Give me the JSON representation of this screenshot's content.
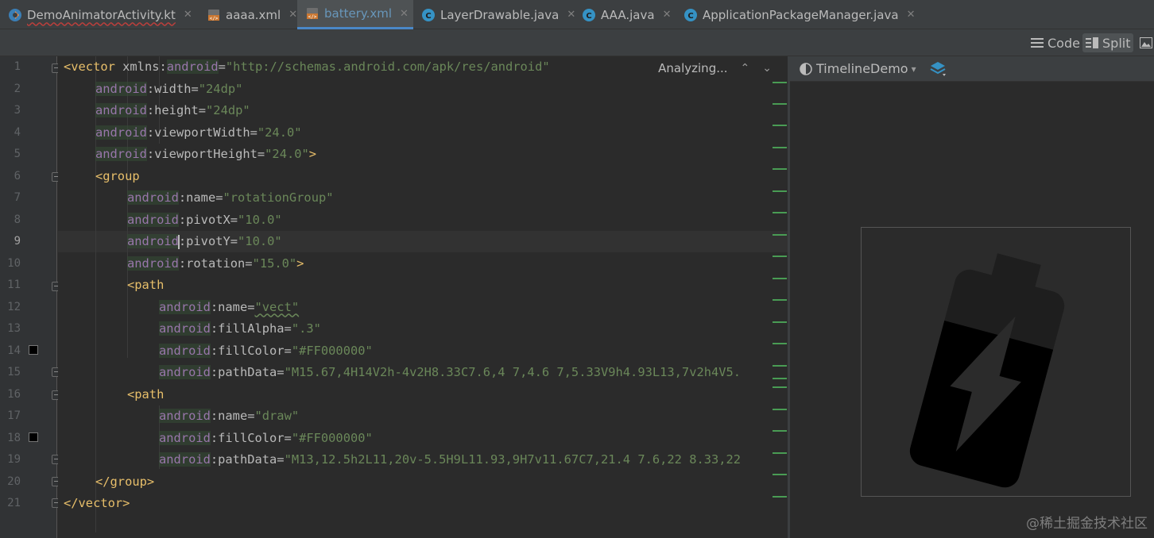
{
  "tabs": [
    {
      "label": "DemoAnimatorActivity.kt",
      "icon": "kotlin-activity-icon",
      "active": false
    },
    {
      "label": "aaaa.xml",
      "icon": "xml-file-icon",
      "active": false
    },
    {
      "label": "battery.xml",
      "icon": "xml-file-icon",
      "active": true
    },
    {
      "label": "LayerDrawable.java",
      "icon": "java-class-icon",
      "active": false
    },
    {
      "label": "AAA.java",
      "icon": "java-class-icon",
      "active": false
    },
    {
      "label": "ApplicationPackageManager.java",
      "icon": "java-class-icon",
      "active": false
    }
  ],
  "view_modes": {
    "code_label": "Code",
    "split_label": "Split",
    "selected": "Split"
  },
  "editor": {
    "status_text": "Analyzing...",
    "current_line": 9,
    "line_numbers": [
      "1",
      "2",
      "3",
      "4",
      "5",
      "6",
      "7",
      "8",
      "9",
      "10",
      "11",
      "12",
      "13",
      "14",
      "15",
      "16",
      "17",
      "18",
      "19",
      "20",
      "21"
    ],
    "lines": [
      {
        "tag_open": "<vector",
        "rest": " xmlns:",
        "ns": "android",
        "eq": "=",
        "val": "\"http://schemas.android.com/apk/res/android\""
      },
      {
        "ns": "android",
        "attr": ":width",
        "eq": "=",
        "val": "\"24dp\""
      },
      {
        "ns": "android",
        "attr": ":height",
        "eq": "=",
        "val": "\"24dp\""
      },
      {
        "ns": "android",
        "attr": ":viewportWidth",
        "eq": "=",
        "val": "\"24.0\""
      },
      {
        "ns": "android",
        "attr": ":viewportHeight",
        "eq": "=",
        "val": "\"24.0\"",
        "close": ">"
      },
      {
        "tag_open": "<group"
      },
      {
        "ns": "android",
        "attr": ":name",
        "eq": "=",
        "val": "\"rotationGroup\""
      },
      {
        "ns": "android",
        "attr": ":pivotX",
        "eq": "=",
        "val": "\"10.0\""
      },
      {
        "ns": "android",
        "attr": ":pivotY",
        "eq": "=",
        "val": "\"10.0\""
      },
      {
        "ns": "android",
        "attr": ":rotation",
        "eq": "=",
        "val": "\"15.0\"",
        "close": ">"
      },
      {
        "tag_open": "<path"
      },
      {
        "ns": "android",
        "attr": ":name",
        "eq": "=",
        "val": "\"vect\""
      },
      {
        "ns": "android",
        "attr": ":fillAlpha",
        "eq": "=",
        "val": "\".3\""
      },
      {
        "ns": "android",
        "attr": ":fillColor",
        "eq": "=",
        "val": "\"#FF000000\""
      },
      {
        "ns": "android",
        "attr": ":pathData",
        "eq": "=",
        "val": "\"M15.67,4H14V2h-4v2H8.33C7.6,4 7,4.6 7,5.33V9h4.93L13,7v2h4V5."
      },
      {
        "tag_open": "<path"
      },
      {
        "ns": "android",
        "attr": ":name",
        "eq": "=",
        "val": "\"draw\""
      },
      {
        "ns": "android",
        "attr": ":fillColor",
        "eq": "=",
        "val": "\"#FF000000\""
      },
      {
        "ns": "android",
        "attr": ":pathData",
        "eq": "=",
        "val": "\"M13,12.5h2L11,20v-5.5H9L11.93,9H7v11.67C7,21.4 7.6,22 8.33,22"
      },
      {
        "tag_open": "</group>"
      },
      {
        "tag_open": "</vector>"
      }
    ],
    "color_swatches": {
      "fill_color": "#000000"
    }
  },
  "preview": {
    "theme_label": "TimelineDemo",
    "drawable_rotation_deg": 15
  },
  "watermark": "@稀土掘金技术社区",
  "colors": {
    "accent": "#4a88c7",
    "tag": "#e8bf6a",
    "value": "#6a8759",
    "namespace": "#9876aa"
  }
}
